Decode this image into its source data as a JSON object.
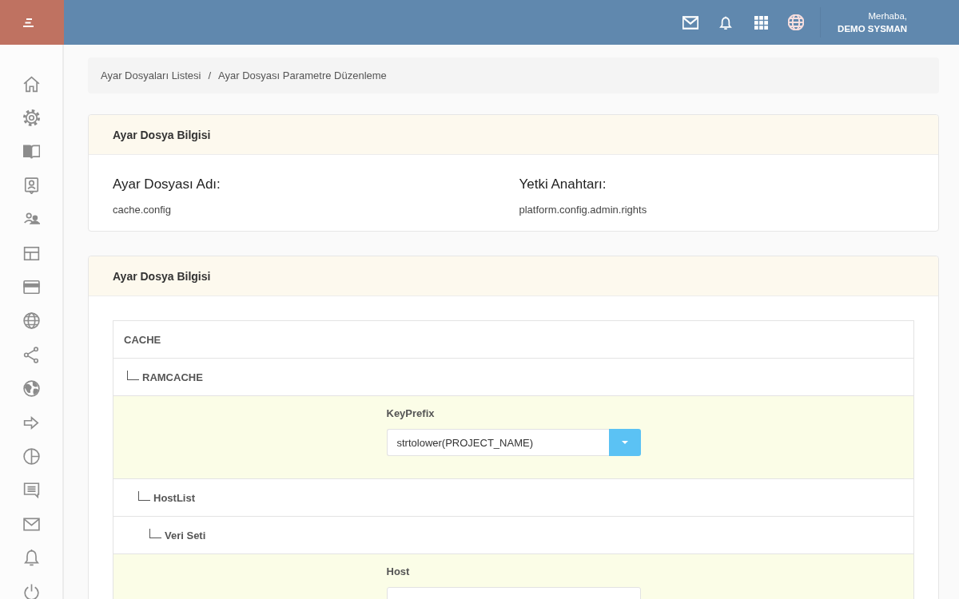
{
  "header": {
    "greeting": "Merhaba,",
    "user_name": "DEMO SYSMAN"
  },
  "breadcrumb": {
    "items": [
      {
        "label": "Ayar Dosyaları Listesi"
      },
      {
        "label": "Ayar Dosyası Parametre Düzenleme"
      }
    ],
    "separator": "/"
  },
  "file_info": {
    "title": "Ayar Dosya Bilgisi",
    "fields": [
      {
        "label": "Ayar Dosyası Adı:",
        "value": "cache.config"
      },
      {
        "label": "Yetki Anahtarı:",
        "value": "platform.config.admin.rights"
      }
    ]
  },
  "parameters": {
    "title": "Ayar Dosya Bilgisi",
    "tree": [
      {
        "kind": "node",
        "label": "CACHE",
        "children": [
          {
            "kind": "node",
            "label": "RAMCACHE",
            "children": [
              {
                "kind": "select",
                "label": "KeyPrefix",
                "value": "strtolower(PROJECT_NAME)"
              },
              {
                "kind": "node",
                "label": "HostList",
                "children": [
                  {
                    "kind": "node",
                    "label": "Veri Seti",
                    "children": [
                      {
                        "kind": "input",
                        "label": "Host"
                      }
                    ]
                  }
                ]
              }
            ]
          }
        ]
      }
    ]
  }
}
